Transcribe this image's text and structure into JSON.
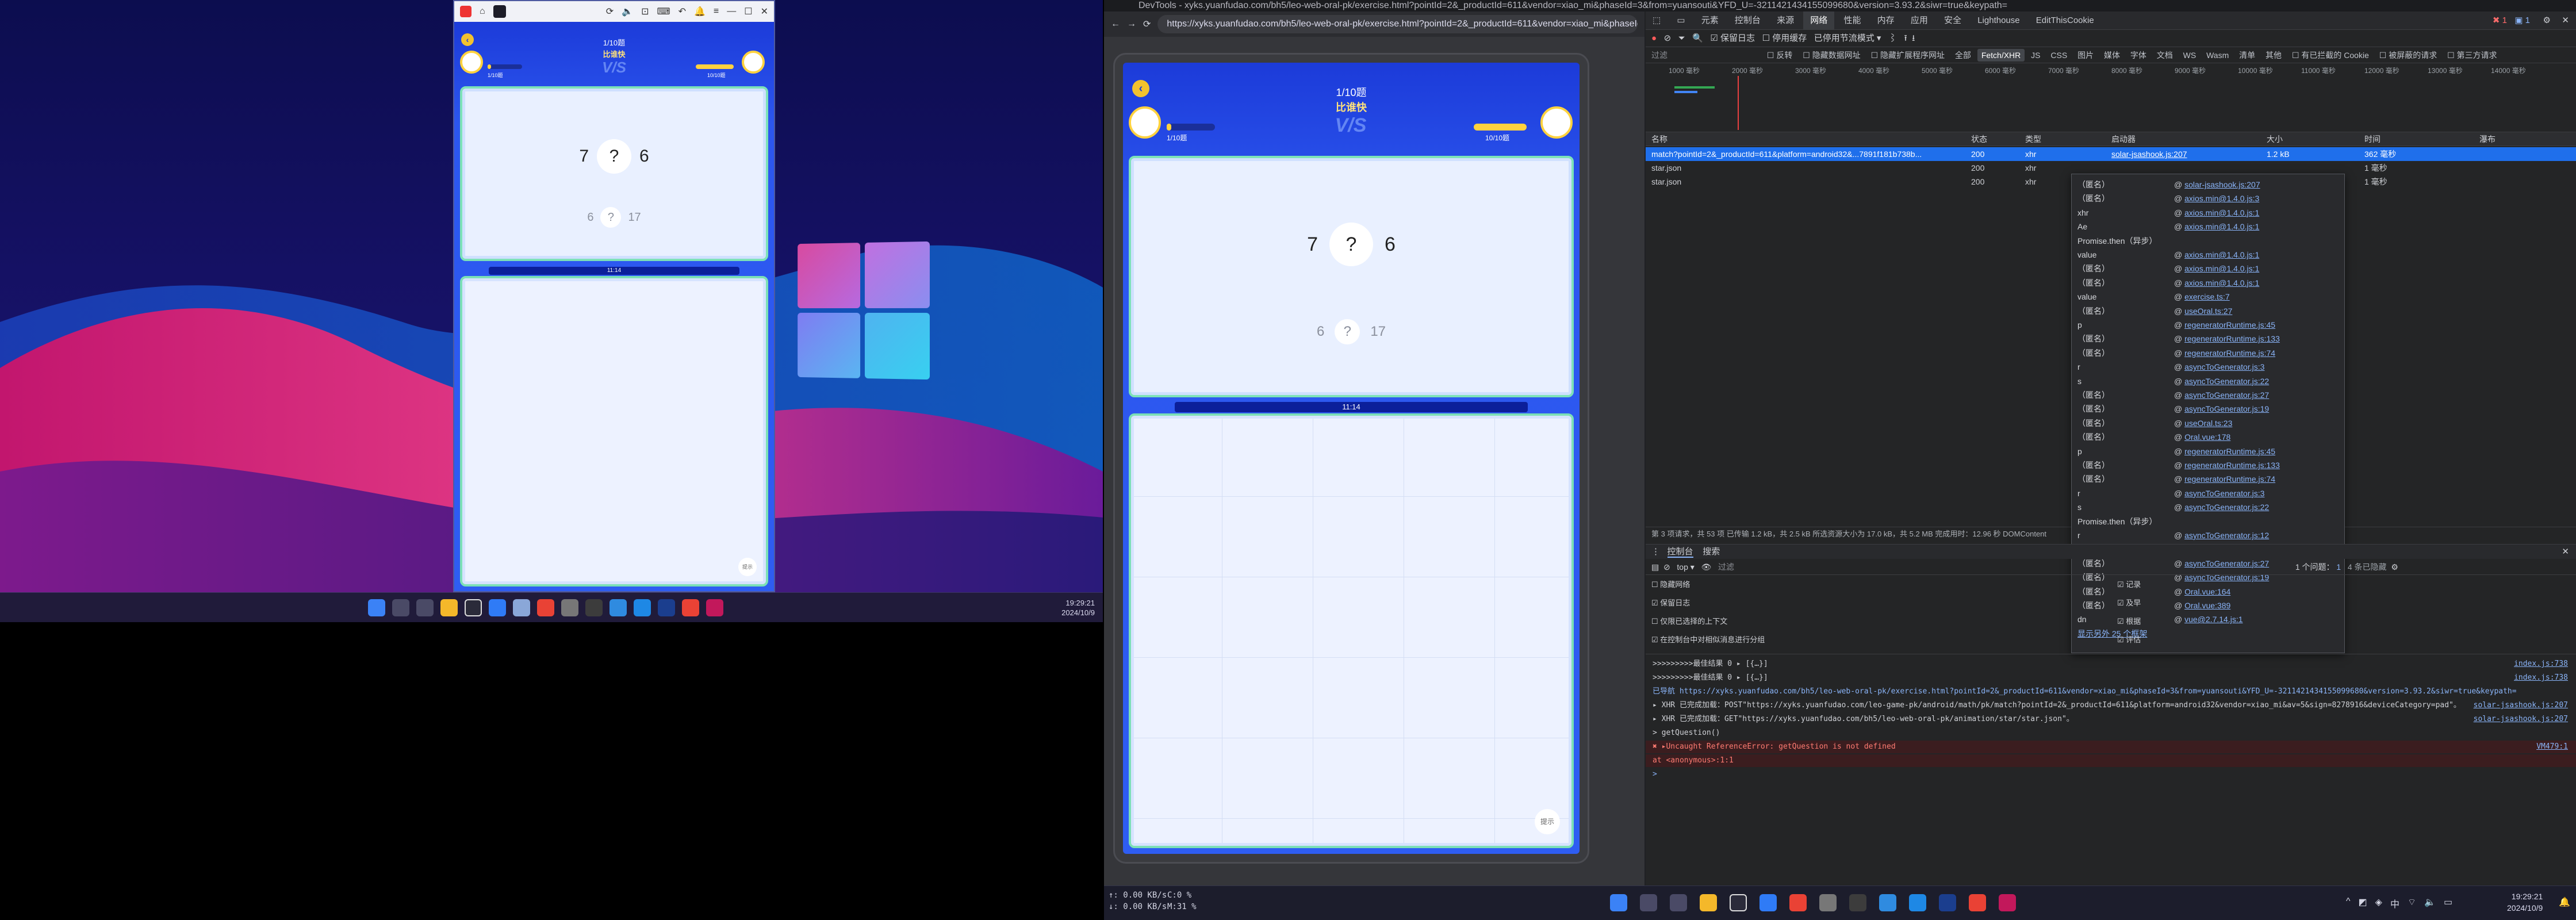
{
  "left_monitor": {
    "emulator": {
      "toolbar_icons": [
        "app-icon",
        "home-icon",
        "game-icon",
        "rotate-icon",
        "volume-icon",
        "screenshot-icon",
        "keyboard-icon",
        "undo-icon",
        "notification-icon",
        "menu-icon",
        "minimize-icon",
        "maximize-icon",
        "close-icon"
      ],
      "game": {
        "progress": "1/10题",
        "mode": "比谁快",
        "player_score": "1/10题",
        "opponent_score": "10/10题",
        "question": {
          "left": "7",
          "mark": "?",
          "right": "6"
        },
        "previous": {
          "left": "6",
          "mark": "?",
          "right": "17"
        },
        "timer": "11:14",
        "hint_label": "提示"
      }
    },
    "taskbar": {
      "time": "19:29:21",
      "date": "2024/10/9"
    }
  },
  "browser": {
    "tab_title": "DevTools - xyks.yuanfudao.com/bh5/leo-web-oral-pk/exercise.html?pointId=2&_productId=611&vendor=xiao_mi&phaseId=3&from=yuansouti&YFD_U=-3211421434155099680&version=3.93.2&siwr=true&keypath=",
    "url": "https://xyks.yuanfudao.com/bh5/leo-web-oral-pk/exercise.html?pointId=2&_productId=611&vendor=xiao_mi&phaseId=3&f",
    "game": {
      "progress": "1/10题",
      "mode": "比谁快",
      "player_score": "1/10题",
      "opponent_score": "10/10题",
      "question": {
        "left": "7",
        "mark": "?",
        "right": "6"
      },
      "previous": {
        "left": "6",
        "mark": "?",
        "right": "17"
      },
      "timer": "11:14",
      "hint_label": "提示"
    }
  },
  "devtools": {
    "tabs": [
      "元素",
      "控制台",
      "来源",
      "网络",
      "性能",
      "内存",
      "应用",
      "安全",
      "Lighthouse",
      "EditThisCookie"
    ],
    "active_tab": "网络",
    "badges": {
      "errors": "1",
      "warnings": "1"
    },
    "network_toolbar": {
      "preserve_log": "保留日志",
      "disable_cache": "停用缓存",
      "throttle": "已停用节流模式"
    },
    "filter_row": {
      "placeholder": "过滤",
      "options": [
        "反转",
        "隐藏数据网址",
        "隐藏扩展程序网址",
        "全部",
        "Fetch/XHR",
        "JS",
        "CSS",
        "图片",
        "媒体",
        "字体",
        "文档",
        "WS",
        "Wasm",
        "清单",
        "其他"
      ],
      "active": "Fetch/XHR",
      "checks": [
        "有已拦截的 Cookie",
        "被屏蔽的请求",
        "第三方请求"
      ]
    },
    "timeline_ticks": [
      "1000 毫秒",
      "2000 毫秒",
      "3000 毫秒",
      "4000 毫秒",
      "5000 毫秒",
      "6000 毫秒",
      "7000 毫秒",
      "8000 毫秒",
      "9000 毫秒",
      "10000 毫秒",
      "11000 毫秒",
      "12000 毫秒",
      "13000 毫秒",
      "14000 毫秒"
    ],
    "columns": [
      "名称",
      "状态",
      "类型",
      "启动器",
      "大小",
      "时间",
      "瀑布"
    ],
    "requests": [
      {
        "name": "match?pointId=2&_productId=611&platform=android32&...7891f181b738b...",
        "status": "200",
        "type": "xhr",
        "initiator": "solar-jsashook.js:207",
        "size": "1.2 kB",
        "time": "362 毫秒"
      },
      {
        "name": "star.json",
        "status": "200",
        "type": "xhr",
        "initiator": "",
        "size": "",
        "time": "1 毫秒"
      },
      {
        "name": "star.json",
        "status": "200",
        "type": "xhr",
        "initiator": "",
        "size": "",
        "time": "1 毫秒"
      }
    ],
    "summary": "第 3 项请求，共 53 项   已传输 1.2 kB，共 2.5 kB   所选资源大小为 17.0 kB，共 5.2 MB   完成用时：12.96 秒   DOMContent",
    "initiator_stack": [
      {
        "fn": "（匿名）",
        "at": "solar-jsashook.js:207"
      },
      {
        "fn": "（匿名）",
        "at": "axios.min@1.4.0.js:3"
      },
      {
        "fn": "xhr",
        "at": "axios.min@1.4.0.js:1"
      },
      {
        "fn": "Ae",
        "at": "axios.min@1.4.0.js:1"
      },
      {
        "fn": "Promise.then（异步）",
        "at": ""
      },
      {
        "fn": "value",
        "at": "axios.min@1.4.0.js:1"
      },
      {
        "fn": "（匿名）",
        "at": "axios.min@1.4.0.js:1"
      },
      {
        "fn": "（匿名）",
        "at": "axios.min@1.4.0.js:1"
      },
      {
        "fn": "value",
        "at": "exercise.ts:7"
      },
      {
        "fn": "（匿名）",
        "at": "useOral.ts:27"
      },
      {
        "fn": "p",
        "at": "regeneratorRuntime.js:45"
      },
      {
        "fn": "（匿名）",
        "at": "regeneratorRuntime.js:133"
      },
      {
        "fn": "（匿名）",
        "at": "regeneratorRuntime.js:74"
      },
      {
        "fn": "r",
        "at": "asyncToGenerator.js:3"
      },
      {
        "fn": "s",
        "at": "asyncToGenerator.js:22"
      },
      {
        "fn": "（匿名）",
        "at": "asyncToGenerator.js:27"
      },
      {
        "fn": "（匿名）",
        "at": "asyncToGenerator.js:19"
      },
      {
        "fn": "（匿名）",
        "at": "useOral.ts:23"
      },
      {
        "fn": "（匿名）",
        "at": "Oral.vue:178"
      },
      {
        "fn": "p",
        "at": "regeneratorRuntime.js:45"
      },
      {
        "fn": "（匿名）",
        "at": "regeneratorRuntime.js:133"
      },
      {
        "fn": "（匿名）",
        "at": "regeneratorRuntime.js:74"
      },
      {
        "fn": "r",
        "at": "asyncToGenerator.js:3"
      },
      {
        "fn": "s",
        "at": "asyncToGenerator.js:22"
      },
      {
        "fn": "Promise.then（异步）",
        "at": ""
      },
      {
        "fn": "r",
        "at": "asyncToGenerator.js:12"
      },
      {
        "fn": "s",
        "at": "asyncToGenerator.js:22"
      },
      {
        "fn": "（匿名）",
        "at": "asyncToGenerator.js:27"
      },
      {
        "fn": "（匿名）",
        "at": "asyncToGenerator.js:19"
      },
      {
        "fn": "（匿名）",
        "at": "Oral.vue:164"
      },
      {
        "fn": "（匿名）",
        "at": "Oral.vue:389"
      },
      {
        "fn": "dn",
        "at": "vue@2.7.14.js:1"
      }
    ],
    "stack_more": "显示另外 25 个框架",
    "drawer_tabs": [
      "控制台",
      "搜索"
    ],
    "console_toolbar": {
      "context": "top",
      "filter_placeholder": "过滤",
      "issues": "1 个问题：",
      "issue_count": "1",
      "hidden": "4 条已隐藏"
    },
    "console_settings": [
      "隐藏网络",
      "保留日志",
      "仅限已选择的上下文",
      "在控制台中对相似消息进行分组"
    ],
    "console_settings_right": [
      "记录",
      "及早",
      "根据",
      "评估"
    ],
    "console_lines": [
      {
        "text": ">>>>>>>>>最佳结果 0 ▸ [{…}]",
        "src": "index.js:738",
        "kind": "log"
      },
      {
        "text": ">>>>>>>>>最佳结果 0 ▸ [{…}]",
        "src": "index.js:738",
        "kind": "log"
      },
      {
        "text": "已导航 https://xyks.yuanfudao.com/bh5/leo-web-oral-pk/exercise.html?pointId=2&_productId=611&vendor=xiao_mi&phaseId=3&from=yuansouti&YFD_U=-3211421434155099680&version=3.93.2&siwr=true&keypath=",
        "src": "",
        "kind": "nav"
      },
      {
        "text": "▸ XHR 已完成加载：POST\"https://xyks.yuanfudao.com/leo-game-pk/android/math/pk/match?pointId=2&_productId=611&platform=android32&vendor=xiao_mi&av=5&sign=8278916&deviceCategory=pad\"。",
        "src": "solar-jsashook.js:207",
        "kind": "log"
      },
      {
        "text": "▸ XHR 已完成加载：GET\"https://xyks.yuanfudao.com/bh5/leo-web-oral-pk/animation/star/star.json\"。",
        "src": "solar-jsashook.js:207",
        "kind": "info"
      },
      {
        "text": "> getQuestion()",
        "src": "",
        "kind": "input"
      },
      {
        "text": "✖ ▸Uncaught ReferenceError: getQuestion is not defined",
        "src": "VM479:1",
        "kind": "error"
      },
      {
        "text": "     at <anonymous>:1:1",
        "src": "",
        "kind": "error2"
      },
      {
        "text": ">",
        "src": "",
        "kind": "prompt"
      }
    ]
  },
  "right_taskbar": {
    "net": [
      "↑: 0.00 KB/s",
      "↓: 0.00 KB/s"
    ],
    "sys": [
      "C:0 %",
      "M:31 %"
    ],
    "time": "19:29:21",
    "date": "2024/10/9",
    "ime": "中"
  },
  "colors": {
    "game_blue": "#2c56ef",
    "card_border": "#7de2b8",
    "devtools_bg": "#242526",
    "link": "#8ab4f8",
    "error": "#ff6b6b"
  }
}
